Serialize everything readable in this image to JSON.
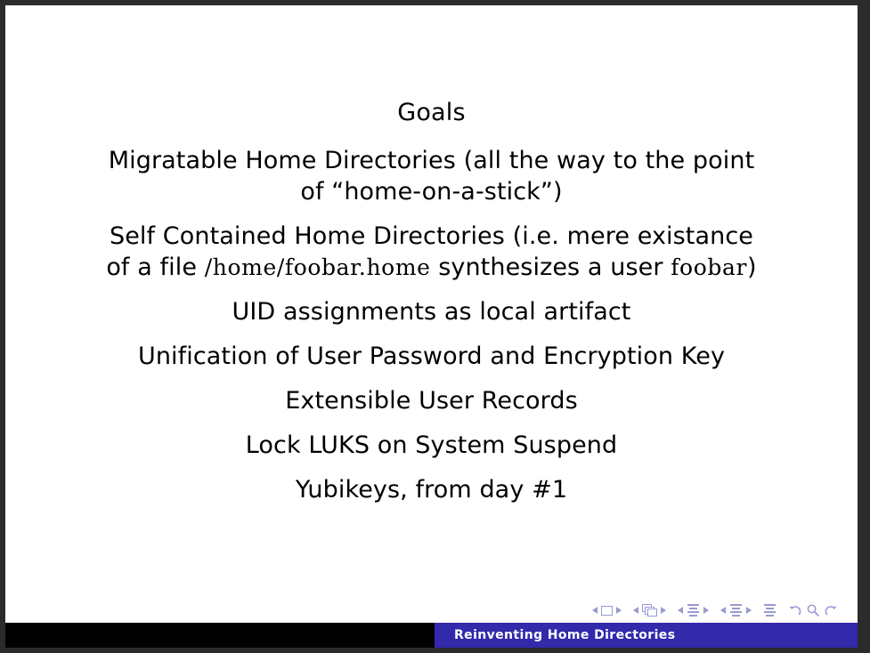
{
  "slide": {
    "frame_title": "Goals",
    "goals": [
      {
        "id": "migratable-home-directories",
        "line1": "Migratable Home Directories (all the way to the point of",
        "line2": "“home-on-a-stick”)",
        "two_line": true
      },
      {
        "id": "self-contained-home-directories",
        "line1": "Self Contained Home Directories (i.e. mere existance of a file",
        "line2_pre": "",
        "mono1": "/home/foobar.home",
        "line2_mid": " synthesizes a user ",
        "mono2": "foobar",
        "line2_post": ")",
        "two_line": true
      },
      {
        "id": "uid-assignments",
        "line1": "UID assignments as local artifact",
        "two_line": false
      },
      {
        "id": "unification-password-encryption-key",
        "line1": "Unification of User Password and Encryption Key",
        "two_line": false
      },
      {
        "id": "extensible-user-records",
        "line1": "Extensible User Records",
        "two_line": false
      },
      {
        "id": "lock-luks-on-suspend",
        "line1": "Lock LUKS on System Suspend",
        "two_line": false
      },
      {
        "id": "yubikeys-from-day-1",
        "line1": "Yubikeys, from day #1",
        "two_line": false
      }
    ]
  },
  "footline": {
    "title": "Reinventing Home Directories",
    "left_color": "#000000",
    "right_color": "#3229ab",
    "text_color": "#ffffff"
  },
  "navigation": {
    "icon_color": "#9a9ad4",
    "items": [
      {
        "name": "previous-slide",
        "glyph": "triangle-left"
      },
      {
        "name": "current-slide",
        "glyph": "slide-square"
      },
      {
        "name": "next-slide",
        "glyph": "triangle-right"
      },
      {
        "name": "previous-frame",
        "glyph": "triangle-left"
      },
      {
        "name": "current-frame",
        "glyph": "stacked-frames"
      },
      {
        "name": "next-frame",
        "glyph": "triangle-right"
      },
      {
        "name": "previous-subsection",
        "glyph": "triangle-left"
      },
      {
        "name": "current-subsection",
        "glyph": "lines"
      },
      {
        "name": "next-subsection",
        "glyph": "triangle-right"
      },
      {
        "name": "previous-section",
        "glyph": "triangle-left"
      },
      {
        "name": "current-section",
        "glyph": "lines"
      },
      {
        "name": "next-section",
        "glyph": "triangle-right"
      },
      {
        "name": "document",
        "glyph": "lines"
      },
      {
        "name": "go-back",
        "glyph": "arrow-back"
      },
      {
        "name": "search",
        "glyph": "magnifier"
      },
      {
        "name": "go-forward",
        "glyph": "arrow-forward"
      }
    ]
  },
  "page": {
    "background_color": "#ffffff",
    "border_color": "#2b2b2b"
  }
}
